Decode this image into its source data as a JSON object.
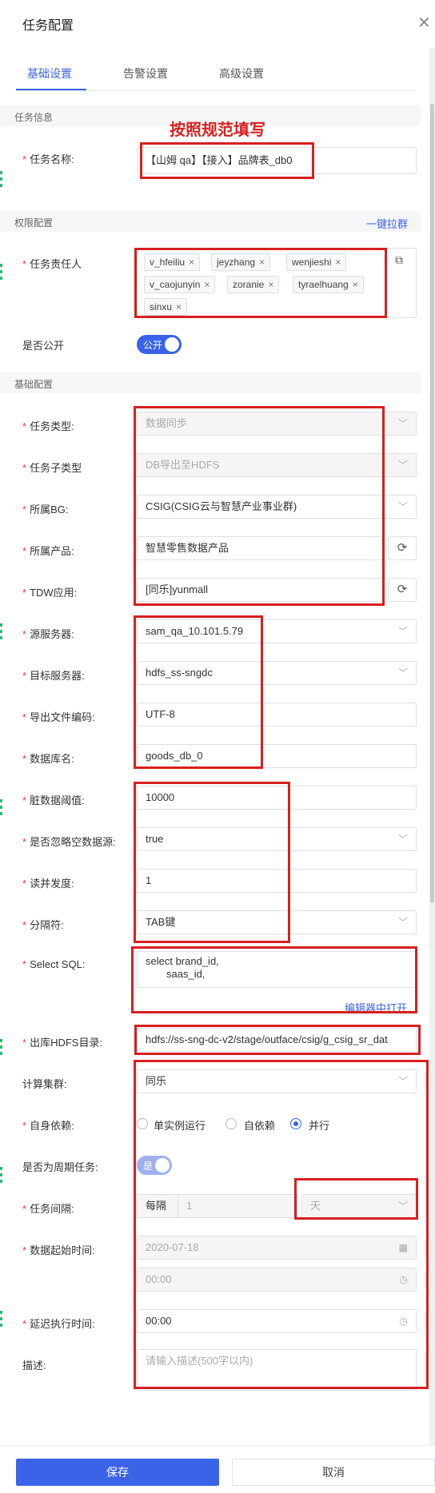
{
  "header": {
    "title": "任务配置"
  },
  "tabs": [
    "基础设置",
    "告警设置",
    "高级设置"
  ],
  "annotation": "按照规范填写",
  "sections": {
    "task_info": "任务信息",
    "permission": "权限配置",
    "basic": "基础配置"
  },
  "one_click_pull": "一键拉群",
  "task_name": {
    "label": "任务名称:",
    "value": "【山姆 qa】【接入】品牌表_db0"
  },
  "owners": {
    "label": "任务责任人",
    "tags": [
      "v_hfeiliu",
      "jeyzhang",
      "wenjieshi",
      "v_caojunyin",
      "zoranie",
      "tyraelhuang",
      "sinxu"
    ]
  },
  "is_public": {
    "label": "是否公开",
    "value": "公开"
  },
  "task_type": {
    "label": "任务类型:",
    "value": "数据同步"
  },
  "task_subtype": {
    "label": "任务子类型",
    "value": "DB导出至HDFS"
  },
  "bg": {
    "label": "所属BG:",
    "value": "CSIG(CSIG云与智慧产业事业群)"
  },
  "product": {
    "label": "所属产品:",
    "value": "智慧零售数据产品"
  },
  "tdw_app": {
    "label": "TDW应用:",
    "value": "[同乐]yunmall"
  },
  "source_server": {
    "label": "源服务器:",
    "value": "sam_qa_10.101.5.79"
  },
  "target_server": {
    "label": "目标服务器:",
    "value": "hdfs_ss-sngdc"
  },
  "encoding": {
    "label": "导出文件编码:",
    "value": "UTF-8"
  },
  "db_name": {
    "label": "数据库名:",
    "value": "goods_db_0"
  },
  "dirty_threshold": {
    "label": "脏数据阈值:",
    "value": "10000"
  },
  "ignore_empty": {
    "label": "是否忽略空数据源:",
    "value": "true"
  },
  "read_concurrency": {
    "label": "读并发度:",
    "value": "1"
  },
  "separator": {
    "label": "分隔符:",
    "value": "TAB键"
  },
  "select_sql": {
    "label": "Select SQL:",
    "line1": "select brand_id,",
    "line2": "saas_id,",
    "open_editor": "编辑器中打开"
  },
  "hdfs_dir": {
    "label": "出库HDFS目录:",
    "value": "hdfs://ss-sng-dc-v2/stage/outface/csig/g_csig_sr_dat"
  },
  "cluster": {
    "label": "计算集群:",
    "value": "同乐"
  },
  "self_dep": {
    "label": "自身依赖:",
    "options": [
      "单实例运行",
      "自依赖",
      "并行"
    ],
    "selected": "并行"
  },
  "is_periodic": {
    "label": "是否为周期任务:",
    "value": "是"
  },
  "interval": {
    "label": "任务间隔:",
    "prefix": "每隔",
    "value": "1",
    "unit": "天"
  },
  "start_time": {
    "label": "数据起始时间:",
    "date": "2020-07-18",
    "time": "00:00"
  },
  "delay": {
    "label": "延迟执行时间:",
    "value": "00:00"
  },
  "description": {
    "label": "描述:",
    "placeholder": "请输入描述(500字以内)"
  },
  "footer": {
    "save": "保存",
    "cancel": "取消"
  }
}
